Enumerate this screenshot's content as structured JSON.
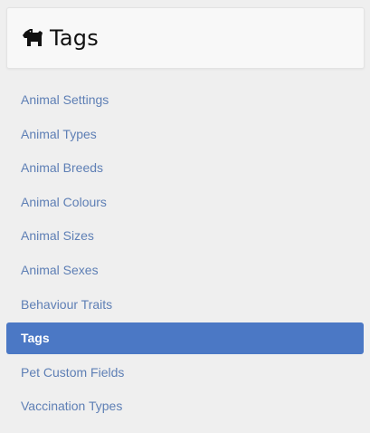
{
  "page": {
    "title": "Tags",
    "icon": "dog-icon"
  },
  "nav": {
    "items": [
      {
        "label": "Animal Settings",
        "active": false
      },
      {
        "label": "Animal Types",
        "active": false
      },
      {
        "label": "Animal Breeds",
        "active": false
      },
      {
        "label": "Animal Colours",
        "active": false
      },
      {
        "label": "Animal Sizes",
        "active": false
      },
      {
        "label": "Animal Sexes",
        "active": false
      },
      {
        "label": "Behaviour Traits",
        "active": false
      },
      {
        "label": "Tags",
        "active": true
      },
      {
        "label": "Pet Custom Fields",
        "active": false
      },
      {
        "label": "Vaccination Types",
        "active": false
      }
    ]
  },
  "colors": {
    "accent": "#4b78c5",
    "link": "#5e7fb5",
    "background": "#efefef"
  }
}
